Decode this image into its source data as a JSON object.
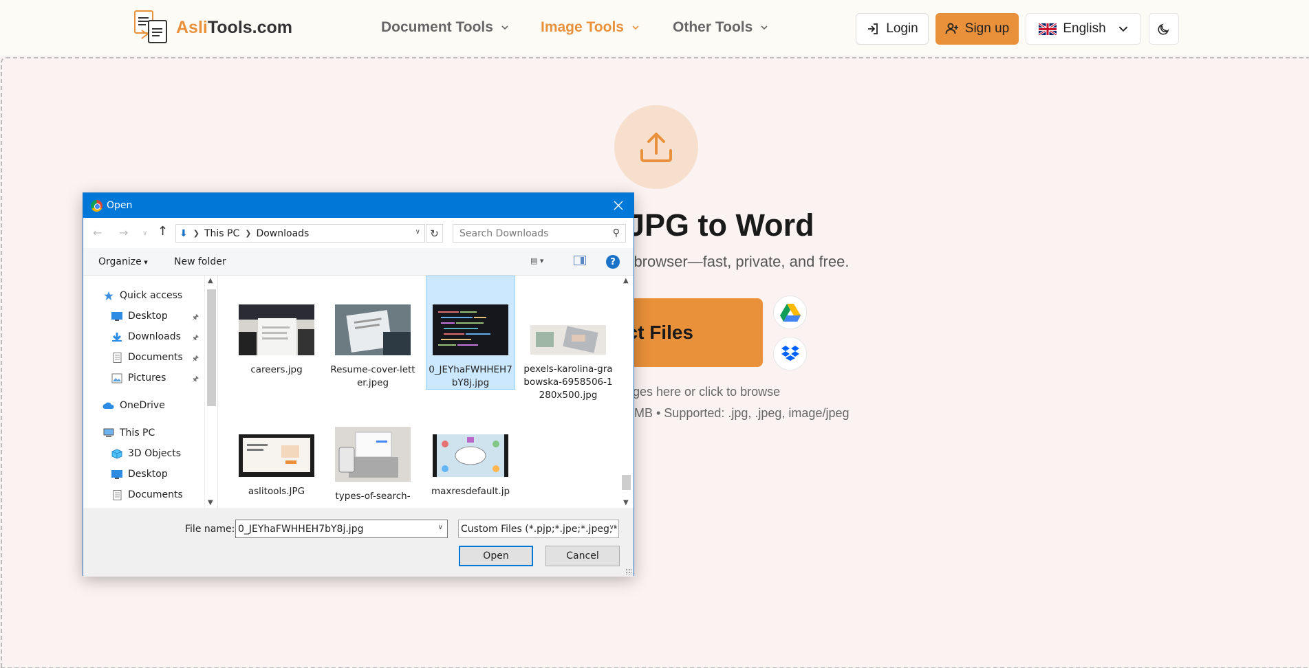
{
  "site": {
    "logo_prefix": "Asli",
    "logo_suffix": "Tools.com",
    "nav": {
      "document_tools": "Document Tools",
      "image_tools": "Image Tools",
      "other_tools": "Other Tools"
    },
    "login_label": "Login",
    "signup_label": "Sign up",
    "language": "English",
    "accent_color": "#e8903a"
  },
  "main": {
    "title": "JPG to Word",
    "subtitle": "r browser—fast, private, and free.",
    "select_label": "ct Files",
    "hint_drag": "ages here or click to browse",
    "hint_supported": "MB • Supported: .jpg, .jpeg, image/jpeg",
    "cloud_icons": [
      "google-drive-icon",
      "dropbox-icon"
    ]
  },
  "dialog": {
    "title": "Open",
    "breadcrumb": [
      "This PC",
      "Downloads"
    ],
    "search_placeholder": "Search Downloads",
    "organize_label": "Organize",
    "new_folder_label": "New folder",
    "help_label": "?",
    "nav_items": [
      {
        "label": "Quick access",
        "icon": "star-icon"
      },
      {
        "label": "Desktop",
        "icon": "desktop-icon",
        "pinned": true
      },
      {
        "label": "Downloads",
        "icon": "downloads-icon",
        "pinned": true
      },
      {
        "label": "Documents",
        "icon": "documents-icon",
        "pinned": true
      },
      {
        "label": "Pictures",
        "icon": "pictures-icon",
        "pinned": true
      },
      {
        "label": "OneDrive",
        "icon": "cloud-icon"
      },
      {
        "label": "This PC",
        "icon": "computer-icon"
      },
      {
        "label": "3D Objects",
        "icon": "cube-icon"
      },
      {
        "label": "Desktop",
        "icon": "desktop-icon"
      },
      {
        "label": "Documents",
        "icon": "documents-icon"
      }
    ],
    "files": [
      {
        "name": "careers.jpg",
        "selected": false
      },
      {
        "name": "Resume-cover-letter.jpeg",
        "selected": false
      },
      {
        "name": "0_JEYhaFWHHEH7bY8j.jpg",
        "selected": true
      },
      {
        "name": "pexels-karolina-grabowska-6958506-1280x500.jpg",
        "selected": false
      },
      {
        "name": "aslitools.JPG",
        "selected": false
      },
      {
        "name": "types-of-search-",
        "selected": false
      },
      {
        "name": "maxresdefault.jp",
        "selected": false
      }
    ],
    "file_name_label": "File name:",
    "file_name_value": "0_JEYhaFWHHEH7bY8j.jpg",
    "filter_value": "Custom Files (*.pjp;*.jpe;*.jpeg;*",
    "open_label": "Open",
    "cancel_label": "Cancel"
  }
}
